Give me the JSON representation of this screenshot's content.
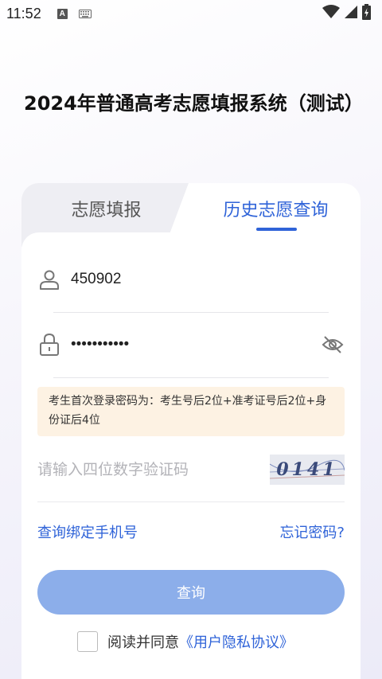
{
  "status_bar": {
    "time": "11:52",
    "notification_icon_letter": "A",
    "icons": [
      "text-notification-icon",
      "keyboard-icon",
      "wifi-icon",
      "signal-icon",
      "battery-icon"
    ]
  },
  "title": "2024年普通高考志愿填报系统（测试）",
  "tabs": [
    {
      "label": "志愿填报",
      "active": false
    },
    {
      "label": "历史志愿查询",
      "active": true
    }
  ],
  "form": {
    "username": {
      "value": "450902",
      "icon": "user-icon"
    },
    "password": {
      "value": "•••••••••••",
      "icon": "lock-icon",
      "toggle_icon": "eye-off-icon"
    },
    "hint": "考生首次登录密码为：考生号后2位+准考证号后2位+身份证后4位",
    "captcha": {
      "placeholder": "请输入四位数字验证码",
      "image_text": "0141"
    }
  },
  "links": {
    "bind_phone": "查询绑定手机号",
    "forgot_password": "忘记密码?"
  },
  "submit_label": "查询",
  "agreement": {
    "prefix": "阅读并同意",
    "link": "《用户隐私协议》",
    "checked": false
  },
  "colors": {
    "accent": "#2f63d8",
    "button_disabled": "#8caeea",
    "hint_bg": "#fdf2e3"
  }
}
